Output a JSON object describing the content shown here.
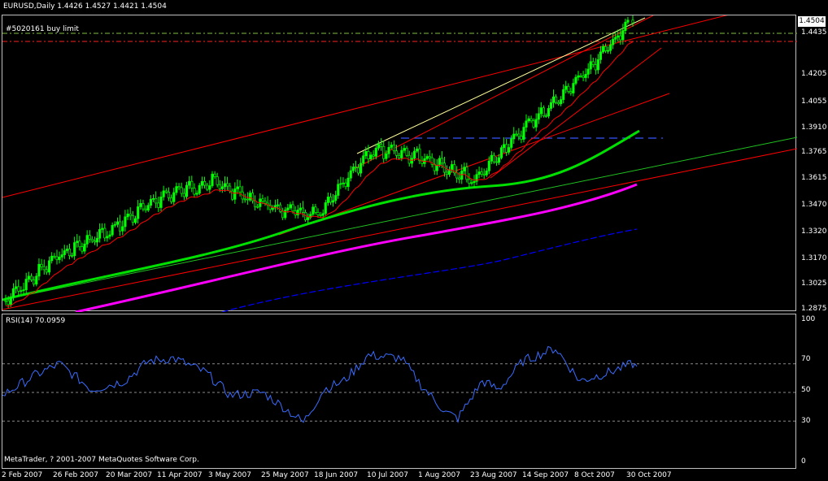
{
  "chart": {
    "header": "EURUSD,Daily  1.4426 1.4527 1.4421 1.4504",
    "order_label": "#5020161 buy limit",
    "current_price": "1.4504",
    "price_ticks": [
      "1.4435",
      "1.4205",
      "1.4055",
      "1.3910",
      "1.3765",
      "1.3615",
      "1.3470",
      "1.3320",
      "1.3170",
      "1.3025",
      "1.2875"
    ],
    "date_ticks": [
      "2 Feb 2007",
      "26 Feb 2007",
      "20 Mar 2007",
      "11 Apr 2007",
      "3 May 2007",
      "25 May 2007",
      "18 Jun 2007",
      "10 Jul 2007",
      "1 Aug 2007",
      "23 Aug 2007",
      "14 Sep 2007",
      "8 Oct 2007",
      "30 Oct 2007"
    ],
    "colors": {
      "candle": "#00ff00",
      "ma_fast": "#ff0000",
      "ma_mid": "#00e000",
      "ma_slow": "#ff00ff",
      "ma_long": "#0000ff",
      "channel": "#ff0000",
      "trend": "#ffff99",
      "rsi": "#3b6cff"
    }
  },
  "rsi": {
    "label": "RSI(14) 70.0959",
    "ticks": [
      "100",
      "70",
      "50",
      "30",
      "0"
    ]
  },
  "footer": "MetaTrader, ? 2001-2007 MetaQuotes Software Corp.",
  "chart_data": {
    "type": "candlestick",
    "title": "EURUSD,Daily",
    "ylim": [
      1.2875,
      1.4504
    ],
    "last_ohlc": {
      "open": 1.4426,
      "high": 1.4527,
      "low": 1.4421,
      "close": 1.4504
    },
    "close_path": [
      {
        "date": "2 Feb 2007",
        "close": 1.292
      },
      {
        "date": "26 Feb 2007",
        "close": 1.317
      },
      {
        "date": "20 Mar 2007",
        "close": 1.332
      },
      {
        "date": "11 Apr 2007",
        "close": 1.351
      },
      {
        "date": "3 May 2007",
        "close": 1.36
      },
      {
        "date": "25 May 2007",
        "close": 1.346
      },
      {
        "date": "18 Jun 2007",
        "close": 1.34
      },
      {
        "date": "10 Jul 2007",
        "close": 1.378
      },
      {
        "date": "1 Aug 2007",
        "close": 1.374
      },
      {
        "date": "23 Aug 2007",
        "close": 1.361
      },
      {
        "date": "14 Sep 2007",
        "close": 1.391
      },
      {
        "date": "8 Oct 2007",
        "close": 1.417
      },
      {
        "date": "30 Oct 2007",
        "close": 1.4504
      }
    ],
    "rsi_series": {
      "name": "RSI(14)",
      "ylim": [
        0,
        100
      ],
      "last": 70.0959
    }
  }
}
